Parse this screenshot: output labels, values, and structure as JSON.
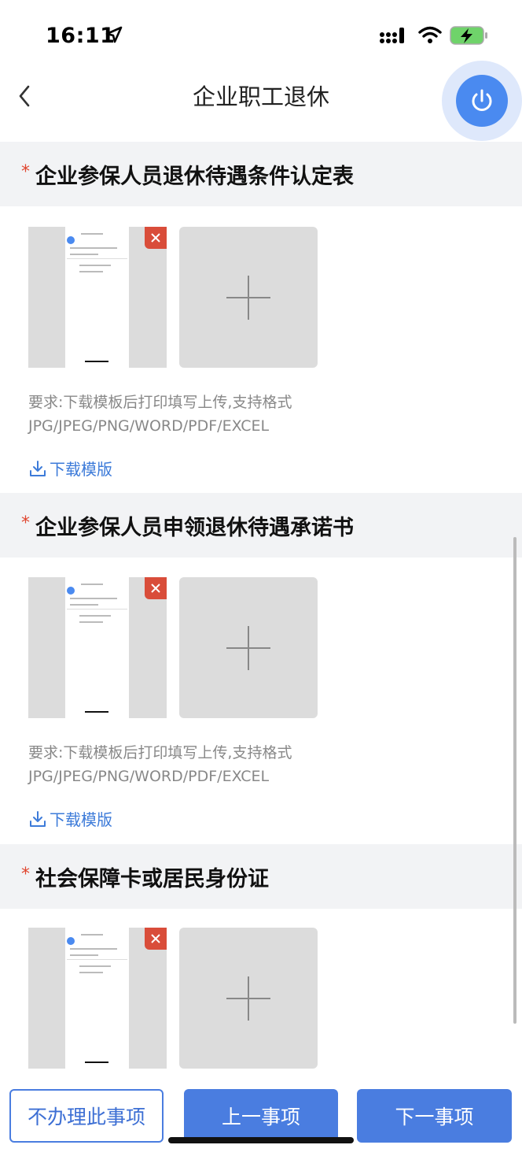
{
  "status_bar": {
    "time": "16:11"
  },
  "nav": {
    "title": "企业职工退休",
    "back_icon": "chevron-left-icon",
    "power_icon": "power-icon"
  },
  "sections": [
    {
      "title": "企业参保人员退休待遇条件认定表",
      "requirement_line1": "要求:下载模板后打印填写上传,支持格式",
      "requirement_line2": "JPG/JPEG/PNG/WORD/PDF/EXCEL",
      "download_label": "下载模版"
    },
    {
      "title": "企业参保人员申领退休待遇承诺书",
      "requirement_line1": "要求:下载模板后打印填写上传,支持格式",
      "requirement_line2": "JPG/JPEG/PNG/WORD/PDF/EXCEL",
      "download_label": "下载模版"
    },
    {
      "title": "社会保障卡或居民身份证"
    }
  ],
  "required_mark": "*",
  "buttons": {
    "skip": "不办理此事项",
    "prev": "上一事项",
    "next": "下一事项"
  },
  "colors": {
    "accent": "#4a7de0",
    "required": "#e0452e",
    "delete": "#d94d3a"
  }
}
